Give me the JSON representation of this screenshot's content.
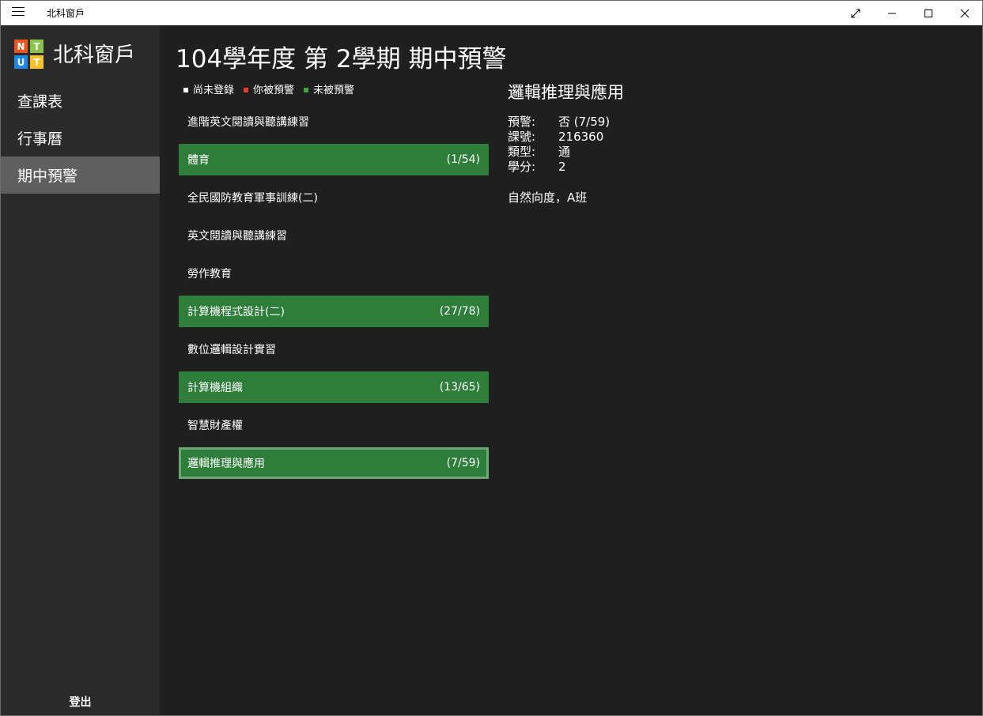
{
  "window": {
    "title": "北科窗戶"
  },
  "sidebar": {
    "brand": "北科窗戶",
    "logo_letters": [
      "N",
      "T",
      "U",
      "T"
    ],
    "logo_colors": [
      "#e95420",
      "#8bc34a",
      "#1e88e5",
      "#fbc02d"
    ],
    "items": [
      {
        "label": "查課表"
      },
      {
        "label": "行事曆"
      },
      {
        "label": "期中預警"
      }
    ],
    "active_index": 2,
    "logout_label": "登出"
  },
  "main": {
    "title": "104學年度 第 2學期 期中預警",
    "legend": [
      {
        "label": "尚未登錄",
        "color": "#ffffff"
      },
      {
        "label": "你被預警",
        "color": "#e53935"
      },
      {
        "label": "未被預警",
        "color": "#43a047"
      }
    ],
    "courses": [
      {
        "name": "進階英文閱讀與聽講練習",
        "ratio": "",
        "status": "none"
      },
      {
        "name": "體育",
        "ratio": "(1/54)",
        "status": "not-warned"
      },
      {
        "name": "全民國防教育軍事訓練(二)",
        "ratio": "",
        "status": "none"
      },
      {
        "name": "英文閱讀與聽講練習",
        "ratio": "",
        "status": "none"
      },
      {
        "name": "勞作教育",
        "ratio": "",
        "status": "none"
      },
      {
        "name": "計算機程式設計(二)",
        "ratio": "(27/78)",
        "status": "not-warned"
      },
      {
        "name": "數位邏輯設計實習",
        "ratio": "",
        "status": "none"
      },
      {
        "name": "計算機組織",
        "ratio": "(13/65)",
        "status": "not-warned"
      },
      {
        "name": "智慧財產權",
        "ratio": "",
        "status": "none"
      },
      {
        "name": "邏輯推理與應用",
        "ratio": "(7/59)",
        "status": "not-warned",
        "selected": true
      }
    ]
  },
  "detail": {
    "title": "邏輯推理與應用",
    "fields": [
      {
        "key": "預警:",
        "value": "否 (7/59)"
      },
      {
        "key": "課號:",
        "value": "216360"
      },
      {
        "key": "類型:",
        "value": "通"
      },
      {
        "key": "學分:",
        "value": "2"
      }
    ],
    "note": "自然向度，A班"
  },
  "colors": {
    "accent_green": "#2e7d3a",
    "sidebar_bg": "#2b2b2b",
    "main_bg": "#1f1f1f"
  }
}
